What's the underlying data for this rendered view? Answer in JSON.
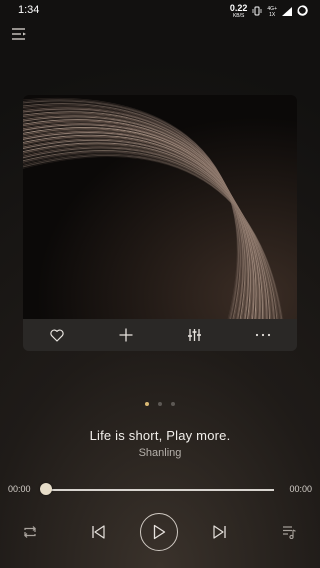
{
  "status_bar": {
    "time": "1:34",
    "net_speed_value": "0.22",
    "net_speed_unit": "KB/S",
    "network_type_top": "4G+",
    "network_type_bottom": "1X"
  },
  "album": {
    "art_description_icon": "album-art-image"
  },
  "card_actions": [
    {
      "name": "favorite",
      "icon": "heart-icon"
    },
    {
      "name": "add",
      "icon": "plus-icon"
    },
    {
      "name": "equalizer",
      "icon": "equalizer-icon"
    },
    {
      "name": "more",
      "icon": "more-icon"
    }
  ],
  "pager": {
    "count": 3,
    "active_index": 0
  },
  "track": {
    "title": "Life is short, Play more.",
    "artist": "Shanling"
  },
  "progress": {
    "elapsed": "00:00",
    "total": "00:00",
    "fraction": 0
  },
  "controls": {
    "repeat_icon": "repeat-icon",
    "previous_icon": "previous-icon",
    "play_icon": "play-icon",
    "next_icon": "next-icon",
    "playlist_icon": "playlist-icon"
  },
  "colors": {
    "accent": "#d9b873",
    "background": "#1f1b18"
  }
}
